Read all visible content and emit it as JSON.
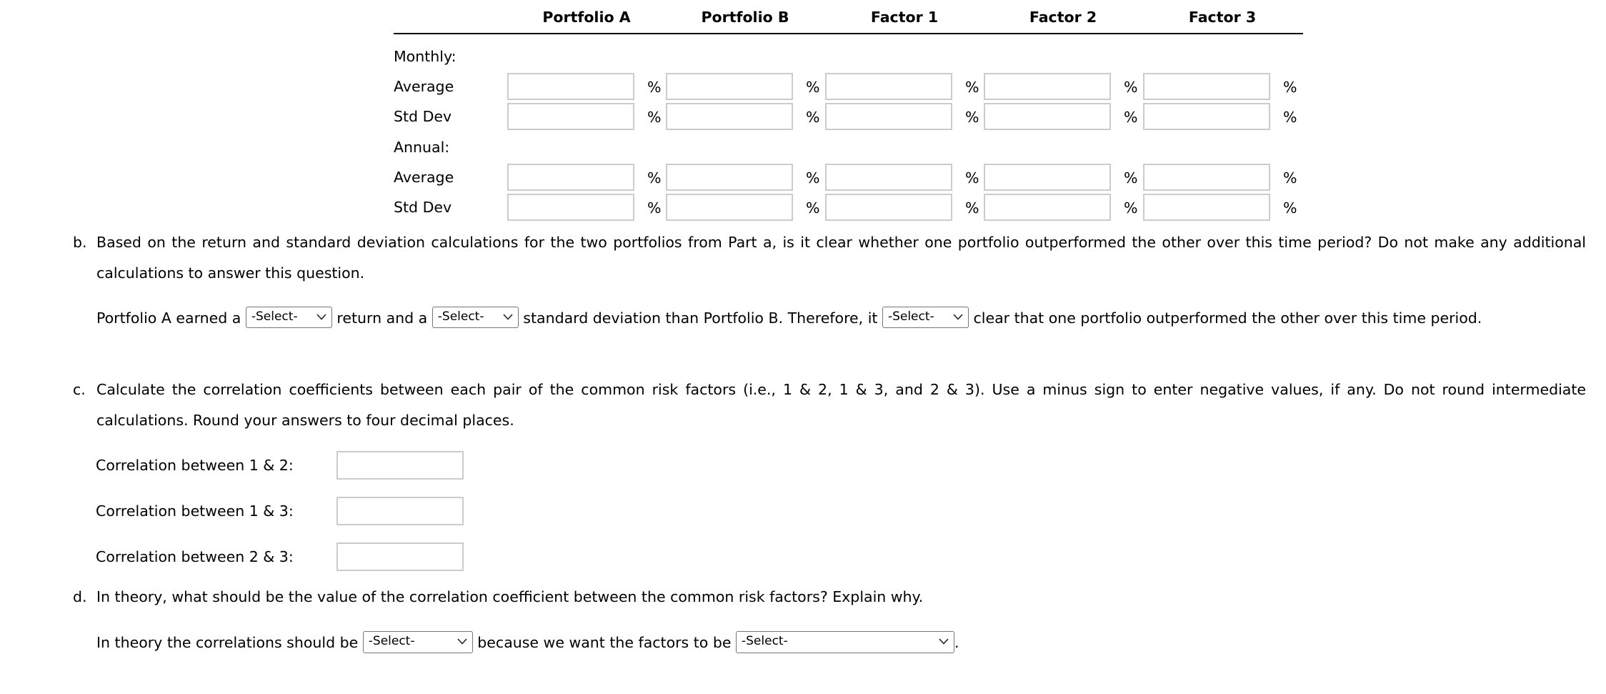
{
  "part_a": {
    "columns": [
      "Portfolio A",
      "Portfolio B",
      "Factor 1",
      "Factor 2",
      "Factor 3"
    ],
    "unit": "%",
    "sections": [
      {
        "label": "Monthly:",
        "rows": [
          {
            "label": "Average",
            "values": [
              "",
              "",
              "",
              "",
              ""
            ]
          },
          {
            "label": "Std Dev",
            "values": [
              "",
              "",
              "",
              "",
              ""
            ]
          }
        ]
      },
      {
        "label": "Annual:",
        "rows": [
          {
            "label": "Average",
            "values": [
              "",
              "",
              "",
              "",
              ""
            ]
          },
          {
            "label": "Std Dev",
            "values": [
              "",
              "",
              "",
              "",
              ""
            ]
          }
        ]
      }
    ]
  },
  "part_b": {
    "marker": "b.",
    "question": "Based on the return and standard deviation calculations for the two portfolios from Part a, is it clear whether one portfolio outperformed the other over this time period? Do not make any additional calculations to answer this question.",
    "answer_parts": {
      "t1": "Portfolio A earned a",
      "t2": "return and a",
      "t3": "standard deviation than Portfolio B. Therefore, it",
      "t4": "clear that one portfolio outperformed the other over this time period."
    },
    "selects": [
      {
        "selected": "-Select-"
      },
      {
        "selected": "-Select-"
      },
      {
        "selected": "-Select-"
      }
    ]
  },
  "part_c": {
    "marker": "c.",
    "question": "Calculate the correlation coefficients between each pair of the common risk factors (i.e., 1 & 2, 1 & 3, and 2 & 3). Use a minus sign to enter negative values, if any. Do not round intermediate calculations. Round your answers to four decimal places.",
    "fields": [
      {
        "label": "Correlation between 1 & 2:",
        "value": ""
      },
      {
        "label": "Correlation between 1 & 3:",
        "value": ""
      },
      {
        "label": "Correlation between 2 & 3:",
        "value": ""
      }
    ]
  },
  "part_d": {
    "marker": "d.",
    "question": "In theory, what should be the value of the correlation coefficient between the common risk factors? Explain why.",
    "answer_parts": {
      "t1": "In theory the correlations should be",
      "t2": "because we want the factors to be",
      "t3": "."
    },
    "selects": [
      {
        "selected": "-Select-"
      },
      {
        "selected": "-Select-"
      }
    ]
  },
  "icons": {
    "dropdown": "chevron-down-icon"
  },
  "colors": {
    "input_border": "#cccccc",
    "select_border": "#767676",
    "text": "#000000",
    "rule": "#000000"
  }
}
